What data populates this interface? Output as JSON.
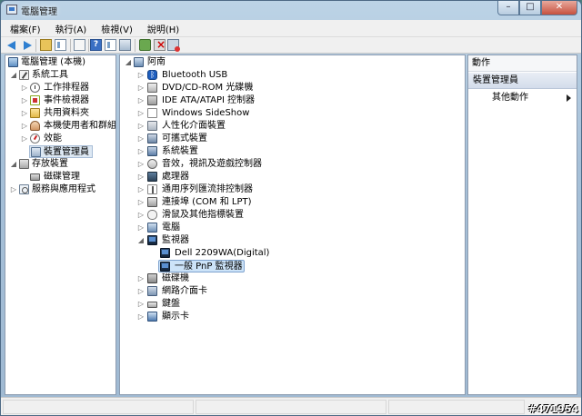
{
  "window": {
    "title": "電腦管理"
  },
  "menu": [
    "檔案(F)",
    "執行(A)",
    "檢視(V)",
    "說明(H)"
  ],
  "toolbar": {
    "icons": [
      "back-icon",
      "forward-icon",
      "up-icon",
      "show-hide-tree-icon",
      "help-icon",
      "properties-icon",
      "scan-hardware-icon",
      "update-driver-icon",
      "disable-device-icon",
      "uninstall-device-icon"
    ]
  },
  "left_tree": [
    {
      "label": "電腦管理 (本機)",
      "icon": "computer-icon",
      "expander": ""
    },
    {
      "label": "系統工具",
      "icon": "tools-icon",
      "expander": "◢"
    },
    {
      "label": "工作排程器",
      "icon": "clock-icon",
      "expander": "▷"
    },
    {
      "label": "事件檢視器",
      "icon": "event-icon",
      "expander": "▷"
    },
    {
      "label": "共用資料夾",
      "icon": "folder-icon",
      "expander": "▷"
    },
    {
      "label": "本機使用者和群組",
      "icon": "users-icon",
      "expander": "▷"
    },
    {
      "label": "效能",
      "icon": "performance-icon",
      "expander": "▷"
    },
    {
      "label": "裝置管理員",
      "icon": "device-manager-icon",
      "expander": ""
    },
    {
      "label": "存放裝置",
      "icon": "storage-icon",
      "expander": "◢"
    },
    {
      "label": "磁碟管理",
      "icon": "disk-icon",
      "expander": ""
    },
    {
      "label": "服務與應用程式",
      "icon": "services-icon",
      "expander": "▷"
    }
  ],
  "device_tree": {
    "root": "阿南",
    "categories": [
      {
        "label": "Bluetooth USB",
        "icon": "bluetooth-icon",
        "expander": "▷"
      },
      {
        "label": "DVD/CD-ROM 光碟機",
        "icon": "dvd-icon",
        "expander": "▷"
      },
      {
        "label": "IDE ATA/ATAPI 控制器",
        "icon": "ide-icon",
        "expander": "▷"
      },
      {
        "label": "Windows SideShow",
        "icon": "sideshow-icon",
        "expander": "▷"
      },
      {
        "label": "人性化介面裝置",
        "icon": "hid-icon",
        "expander": "▷"
      },
      {
        "label": "可攜式裝置",
        "icon": "portable-device-icon",
        "expander": "▷"
      },
      {
        "label": "系統裝置",
        "icon": "system-device-icon",
        "expander": "▷"
      },
      {
        "label": "音效，視訊及遊戲控制器",
        "icon": "sound-icon",
        "expander": "▷"
      },
      {
        "label": "處理器",
        "icon": "cpu-icon",
        "expander": "▷"
      },
      {
        "label": "通用序列匯流排控制器",
        "icon": "usb-icon",
        "expander": "▷"
      },
      {
        "label": "連接埠 (COM 和 LPT)",
        "icon": "port-icon",
        "expander": "▷"
      },
      {
        "label": "滑鼠及其他指標裝置",
        "icon": "mouse-icon",
        "expander": "▷"
      },
      {
        "label": "電腦",
        "icon": "pc-icon",
        "expander": "▷"
      },
      {
        "label": "監視器",
        "icon": "monitor-icon",
        "expander": "◢"
      },
      {
        "label": "Dell 2209WA(Digital)",
        "icon": "monitor-icon",
        "expander": "",
        "child": true
      },
      {
        "label": "一般 PnP 監視器",
        "icon": "monitor-icon",
        "expander": "",
        "child": true,
        "selected": true
      },
      {
        "label": "磁碟機",
        "icon": "floppy-icon",
        "expander": "▷"
      },
      {
        "label": "網路介面卡",
        "icon": "network-adapter-icon",
        "expander": "▷"
      },
      {
        "label": "鍵盤",
        "icon": "keyboard-icon",
        "expander": "▷"
      },
      {
        "label": "顯示卡",
        "icon": "display-adapter-icon",
        "expander": "▷"
      }
    ]
  },
  "actions": {
    "header": "動作",
    "section": "裝置管理員",
    "item": "其他動作"
  },
  "watermark": "#471954"
}
